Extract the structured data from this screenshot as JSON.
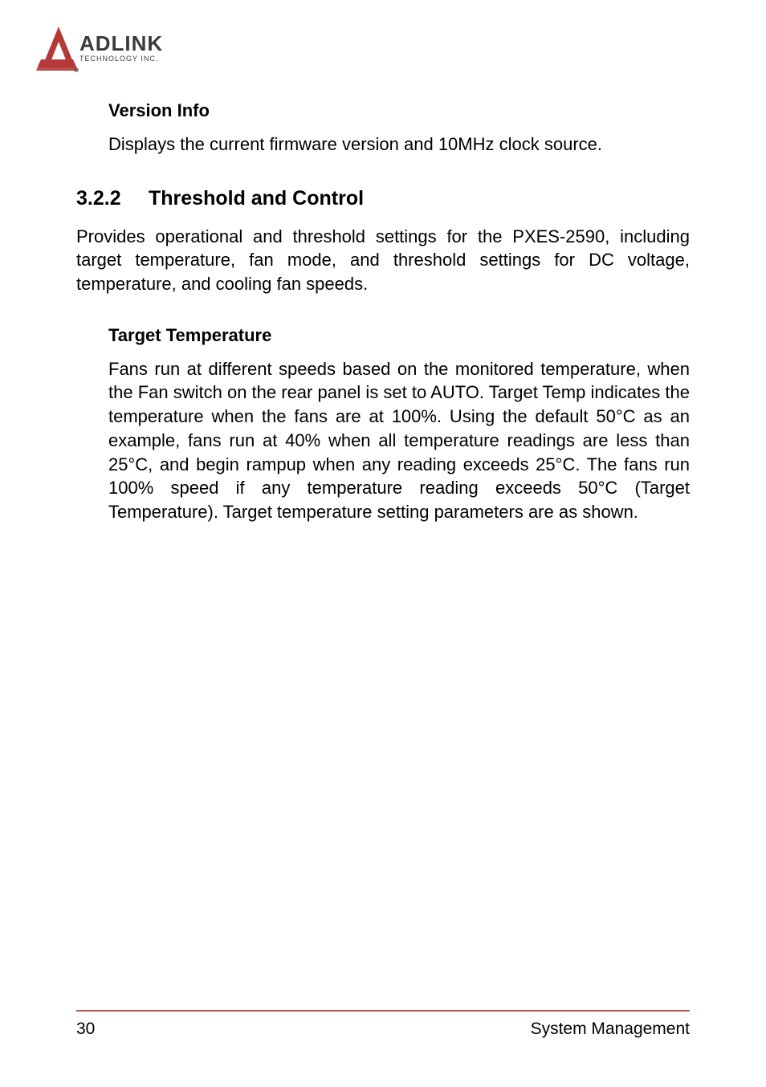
{
  "logo": {
    "brand_top": "ADLINK",
    "brand_bottom": "TECHNOLOGY INC."
  },
  "section_version": {
    "heading": "Version Info",
    "text": "Displays the current firmware version and 10MHz clock source."
  },
  "section_threshold": {
    "number": "3.2.2",
    "title": "Threshold and Control",
    "body": "Provides operational and threshold settings for the PXES-2590, including target temperature, fan mode, and threshold settings for DC voltage, temperature, and cooling fan speeds."
  },
  "section_target_temp": {
    "heading": "Target Temperature",
    "body": "Fans run at different speeds based on the monitored temperature, when the Fan switch on the rear panel is set to AUTO. Target Temp indicates the temperature when the fans are at 100%. Using the default 50°C as an example, fans run at 40% when all temperature readings are less than 25°C, and begin rampup when any reading exceeds 25°C. The fans run 100% speed if any temperature reading exceeds 50°C (Target Temperature). Target temperature setting parameters are as shown."
  },
  "footer": {
    "page_number": "30",
    "chapter": "System Management"
  }
}
